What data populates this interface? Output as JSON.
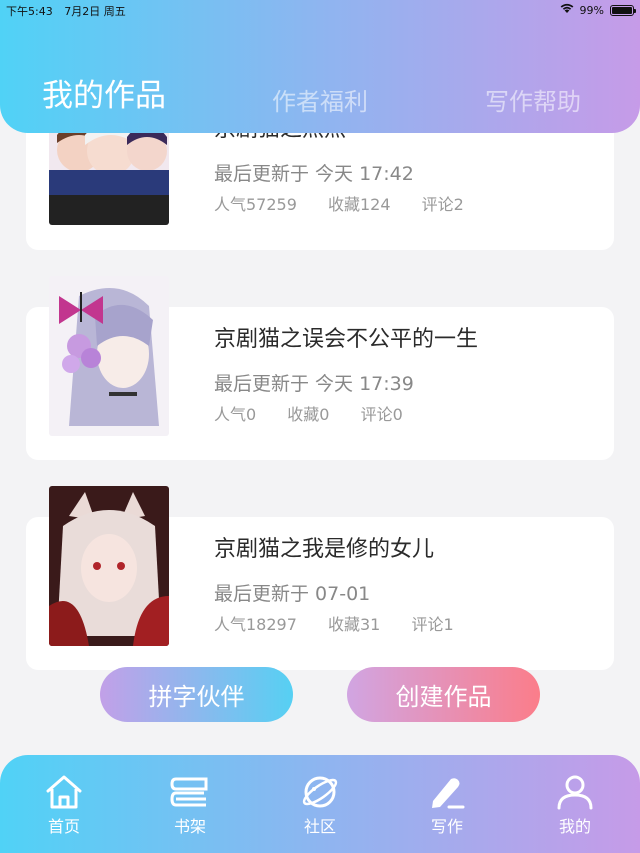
{
  "status_bar": {
    "time": "下午5:43",
    "date": "7月2日 周五",
    "battery": "99%",
    "battery_level": 0.99
  },
  "header": {
    "tabs": [
      {
        "label": "我的作品",
        "active": true
      },
      {
        "label": "作者福利",
        "active": false
      },
      {
        "label": "写作帮助",
        "active": false
      }
    ]
  },
  "works": [
    {
      "title": "京剧猫之燕燕",
      "update": "最后更新于 今天 17:42",
      "popularity": "人气57259",
      "favorites": "收藏124",
      "comments": "评论2"
    },
    {
      "title": "京剧猫之误会不公平的一生",
      "update": "最后更新于 今天 17:39",
      "popularity": "人气0",
      "favorites": "收藏0",
      "comments": "评论0"
    },
    {
      "title": "京剧猫之我是修的女儿",
      "update": "最后更新于 07-01",
      "popularity": "人气18297",
      "favorites": "收藏31",
      "comments": "评论1"
    }
  ],
  "actions": {
    "partner": "拼字伙伴",
    "create": "创建作品"
  },
  "bottom_nav": [
    {
      "label": "首页",
      "icon": "home-icon"
    },
    {
      "label": "书架",
      "icon": "bookshelf-icon"
    },
    {
      "label": "社区",
      "icon": "planet-icon"
    },
    {
      "label": "写作",
      "icon": "pen-icon",
      "active": true
    },
    {
      "label": "我的",
      "icon": "user-icon"
    }
  ],
  "colors": {
    "gradient_start": "#50d2f6",
    "gradient_end": "#c69be8",
    "create_button": "#fb7d8a"
  }
}
